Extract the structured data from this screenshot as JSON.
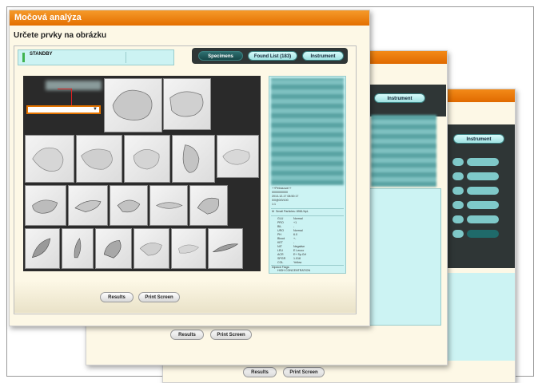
{
  "app": {
    "title": "Močová analýza",
    "heading": "Určete prvky na obrázku"
  },
  "status": {
    "text": "STANDBY"
  },
  "tabs": [
    {
      "label": "Specimens",
      "active": true
    },
    {
      "label": "Found List (183)",
      "active": false
    },
    {
      "label": "Instrument",
      "active": false
    }
  ],
  "buttons": {
    "results": "Results",
    "print": "Print Screen"
  },
  "info_panel": {
    "id_lines": [
      "++Petrasova++",
      "0000000000",
      "2013-12-17 08:50:17",
      "0/0@0/0/100",
      "1:1"
    ],
    "header_line": "M  Small Particles: 8961/hpL",
    "rows": [
      {
        "name": "GLU",
        "value": "Normal",
        "flag": false
      },
      {
        "name": "PRO",
        "value": "+1",
        "flag": true
      },
      {
        "name": "BIL",
        "value": "-",
        "flag": false
      },
      {
        "name": "URO",
        "value": "Normal",
        "flag": false
      },
      {
        "name": "PH",
        "value": "6.0",
        "flag": false
      },
      {
        "name": "Blood",
        "value": "+-",
        "flag": true
      },
      {
        "name": "KET",
        "value": "-",
        "flag": false
      },
      {
        "name": "NIT",
        "value": "Negative",
        "flag": false
      },
      {
        "name": "LEU",
        "value": "E Leuco",
        "flag": false
      },
      {
        "name": "ACR",
        "value": "E+ Sp.Grf",
        "flag": true
      },
      {
        "name": "SPGR",
        "value": "1.018",
        "flag": false
      },
      {
        "name": "COL",
        "value": "Yellow",
        "flag": false
      }
    ],
    "footer_label": "Dipsick Flags:",
    "footer_value": "HIGH CONCENTRATION"
  },
  "back_windows": {
    "w2": {
      "tab_label": "Instrument",
      "buttons": [
        "Results",
        "Print Screen"
      ]
    },
    "w3": {
      "tab_label": "Instrument",
      "buttons": [
        "Results",
        "Print Screen"
      ]
    }
  },
  "colors": {
    "accent": "#e46f00",
    "panel": "#ccf3f3",
    "status_ok": "#3fb34f"
  }
}
